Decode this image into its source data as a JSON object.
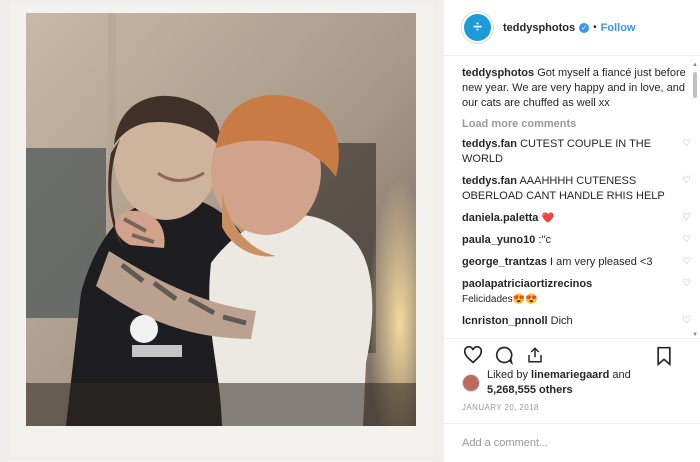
{
  "post": {
    "username": "teddysphotos",
    "follow": "Follow",
    "dot": "•",
    "caption": "Got myself a fiancé just before new year. We are very happy and in love, and our cats are chuffed as well xx",
    "load_more": "Load more comments",
    "comments": [
      {
        "user": "teddys.fan",
        "text": "CUTEST COUPLE IN THE WORLD"
      },
      {
        "user": "teddys.fan",
        "text": "AAAHHHH CUTENESS OBERLOAD CANT HANDLE RHIS HELP"
      },
      {
        "user": "daniela.paletta",
        "text": "❤️"
      },
      {
        "user": "paula_yuno10",
        "text": ":''c"
      },
      {
        "user": "george_trantzas",
        "text": "I am very pleased <3"
      },
      {
        "user": "paolapatriciaortizrecinos",
        "text": "Felicidades😍😍"
      },
      {
        "user": "lcnriston_pnnoll",
        "text": "Dich"
      }
    ],
    "liked_by": "Liked by",
    "liked_by_user": "linemariegaard",
    "liked_and": "and",
    "likes_count": "5,268,555 others",
    "date": "JANUARY 20, 2018",
    "add_comment": "Add a comment..."
  },
  "icons": {
    "avatar": "division-logo-icon",
    "verified": "verified-check-icon",
    "like": "heart-outline-icon",
    "comment": "comment-bubble-icon",
    "share": "share-upload-icon",
    "save": "bookmark-icon"
  }
}
